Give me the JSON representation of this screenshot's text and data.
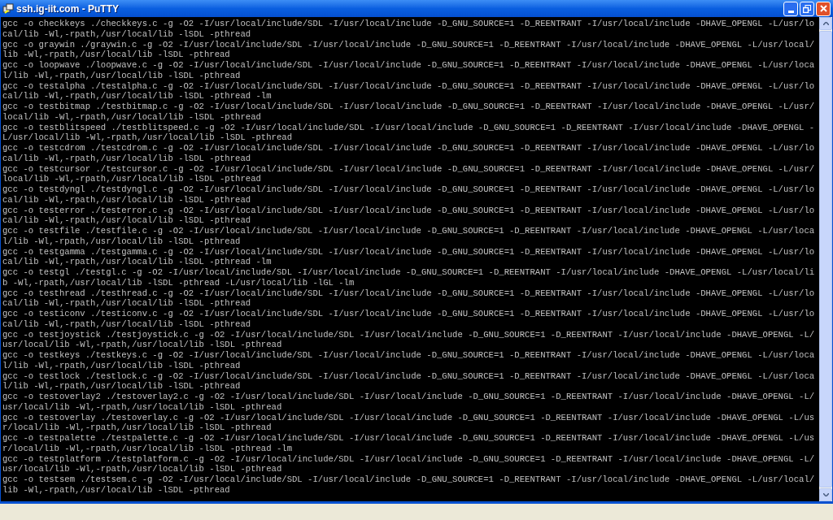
{
  "window": {
    "title": "ssh.ig-iit.com - PuTTY"
  },
  "terminal": {
    "rows": [
      "gcc -o checkkeys ./checkkeys.c -g -O2 -I/usr/local/include/SDL -I/usr/local/include -D_GNU_SOURCE=1 -D_REENTRANT -I/usr/local/include -DHAVE_OPENGL -L/usr/lo",
      "cal/lib -Wl,-rpath,/usr/local/lib -lSDL -pthread",
      "gcc -o graywin ./graywin.c -g -O2 -I/usr/local/include/SDL -I/usr/local/include -D_GNU_SOURCE=1 -D_REENTRANT -I/usr/local/include -DHAVE_OPENGL -L/usr/local/",
      "lib -Wl,-rpath,/usr/local/lib -lSDL -pthread",
      "gcc -o loopwave ./loopwave.c -g -O2 -I/usr/local/include/SDL -I/usr/local/include -D_GNU_SOURCE=1 -D_REENTRANT -I/usr/local/include -DHAVE_OPENGL -L/usr/loca",
      "l/lib -Wl,-rpath,/usr/local/lib -lSDL -pthread",
      "gcc -o testalpha ./testalpha.c -g -O2 -I/usr/local/include/SDL -I/usr/local/include -D_GNU_SOURCE=1 -D_REENTRANT -I/usr/local/include -DHAVE_OPENGL -L/usr/lo",
      "cal/lib -Wl,-rpath,/usr/local/lib -lSDL -pthread -lm",
      "gcc -o testbitmap ./testbitmap.c -g -O2 -I/usr/local/include/SDL -I/usr/local/include -D_GNU_SOURCE=1 -D_REENTRANT -I/usr/local/include -DHAVE_OPENGL -L/usr/",
      "local/lib -Wl,-rpath,/usr/local/lib -lSDL -pthread",
      "gcc -o testblitspeed ./testblitspeed.c -g -O2 -I/usr/local/include/SDL -I/usr/local/include -D_GNU_SOURCE=1 -D_REENTRANT -I/usr/local/include -DHAVE_OPENGL -",
      "L/usr/local/lib -Wl,-rpath,/usr/local/lib -lSDL -pthread",
      "gcc -o testcdrom ./testcdrom.c -g -O2 -I/usr/local/include/SDL -I/usr/local/include -D_GNU_SOURCE=1 -D_REENTRANT -I/usr/local/include -DHAVE_OPENGL -L/usr/lo",
      "cal/lib -Wl,-rpath,/usr/local/lib -lSDL -pthread",
      "gcc -o testcursor ./testcursor.c -g -O2 -I/usr/local/include/SDL -I/usr/local/include -D_GNU_SOURCE=1 -D_REENTRANT -I/usr/local/include -DHAVE_OPENGL -L/usr/",
      "local/lib -Wl,-rpath,/usr/local/lib -lSDL -pthread",
      "gcc -o testdyngl ./testdyngl.c -g -O2 -I/usr/local/include/SDL -I/usr/local/include -D_GNU_SOURCE=1 -D_REENTRANT -I/usr/local/include -DHAVE_OPENGL -L/usr/lo",
      "cal/lib -Wl,-rpath,/usr/local/lib -lSDL -pthread",
      "gcc -o testerror ./testerror.c -g -O2 -I/usr/local/include/SDL -I/usr/local/include -D_GNU_SOURCE=1 -D_REENTRANT -I/usr/local/include -DHAVE_OPENGL -L/usr/lo",
      "cal/lib -Wl,-rpath,/usr/local/lib -lSDL -pthread",
      "gcc -o testfile ./testfile.c -g -O2 -I/usr/local/include/SDL -I/usr/local/include -D_GNU_SOURCE=1 -D_REENTRANT -I/usr/local/include -DHAVE_OPENGL -L/usr/loca",
      "l/lib -Wl,-rpath,/usr/local/lib -lSDL -pthread",
      "gcc -o testgamma ./testgamma.c -g -O2 -I/usr/local/include/SDL -I/usr/local/include -D_GNU_SOURCE=1 -D_REENTRANT -I/usr/local/include -DHAVE_OPENGL -L/usr/lo",
      "cal/lib -Wl,-rpath,/usr/local/lib -lSDL -pthread -lm",
      "gcc -o testgl ./testgl.c -g -O2 -I/usr/local/include/SDL -I/usr/local/include -D_GNU_SOURCE=1 -D_REENTRANT -I/usr/local/include -DHAVE_OPENGL -L/usr/local/li",
      "b -Wl,-rpath,/usr/local/lib -lSDL -pthread -L/usr/local/lib -lGL -lm",
      "gcc -o testhread ./testhread.c -g -O2 -I/usr/local/include/SDL -I/usr/local/include -D_GNU_SOURCE=1 -D_REENTRANT -I/usr/local/include -DHAVE_OPENGL -L/usr/lo",
      "cal/lib -Wl,-rpath,/usr/local/lib -lSDL -pthread",
      "gcc -o testiconv ./testiconv.c -g -O2 -I/usr/local/include/SDL -I/usr/local/include -D_GNU_SOURCE=1 -D_REENTRANT -I/usr/local/include -DHAVE_OPENGL -L/usr/lo",
      "cal/lib -Wl,-rpath,/usr/local/lib -lSDL -pthread",
      "gcc -o testjoystick ./testjoystick.c -g -O2 -I/usr/local/include/SDL -I/usr/local/include -D_GNU_SOURCE=1 -D_REENTRANT -I/usr/local/include -DHAVE_OPENGL -L/",
      "usr/local/lib -Wl,-rpath,/usr/local/lib -lSDL -pthread",
      "gcc -o testkeys ./testkeys.c -g -O2 -I/usr/local/include/SDL -I/usr/local/include -D_GNU_SOURCE=1 -D_REENTRANT -I/usr/local/include -DHAVE_OPENGL -L/usr/loca",
      "l/lib -Wl,-rpath,/usr/local/lib -lSDL -pthread",
      "gcc -o testlock ./testlock.c -g -O2 -I/usr/local/include/SDL -I/usr/local/include -D_GNU_SOURCE=1 -D_REENTRANT -I/usr/local/include -DHAVE_OPENGL -L/usr/loca",
      "l/lib -Wl,-rpath,/usr/local/lib -lSDL -pthread",
      "gcc -o testoverlay2 ./testoverlay2.c -g -O2 -I/usr/local/include/SDL -I/usr/local/include -D_GNU_SOURCE=1 -D_REENTRANT -I/usr/local/include -DHAVE_OPENGL -L/",
      "usr/local/lib -Wl,-rpath,/usr/local/lib -lSDL -pthread",
      "gcc -o testoverlay ./testoverlay.c -g -O2 -I/usr/local/include/SDL -I/usr/local/include -D_GNU_SOURCE=1 -D_REENTRANT -I/usr/local/include -DHAVE_OPENGL -L/us",
      "r/local/lib -Wl,-rpath,/usr/local/lib -lSDL -pthread",
      "gcc -o testpalette ./testpalette.c -g -O2 -I/usr/local/include/SDL -I/usr/local/include -D_GNU_SOURCE=1 -D_REENTRANT -I/usr/local/include -DHAVE_OPENGL -L/us",
      "r/local/lib -Wl,-rpath,/usr/local/lib -lSDL -pthread -lm",
      "gcc -o testplatform ./testplatform.c -g -O2 -I/usr/local/include/SDL -I/usr/local/include -D_GNU_SOURCE=1 -D_REENTRANT -I/usr/local/include -DHAVE_OPENGL -L/",
      "usr/local/lib -Wl,-rpath,/usr/local/lib -lSDL -pthread",
      "gcc -o testsem ./testsem.c -g -O2 -I/usr/local/include/SDL -I/usr/local/include -D_GNU_SOURCE=1 -D_REENTRANT -I/usr/local/include -DHAVE_OPENGL -L/usr/local/",
      "lib -Wl,-rpath,/usr/local/lib -lSDL -pthread"
    ]
  }
}
